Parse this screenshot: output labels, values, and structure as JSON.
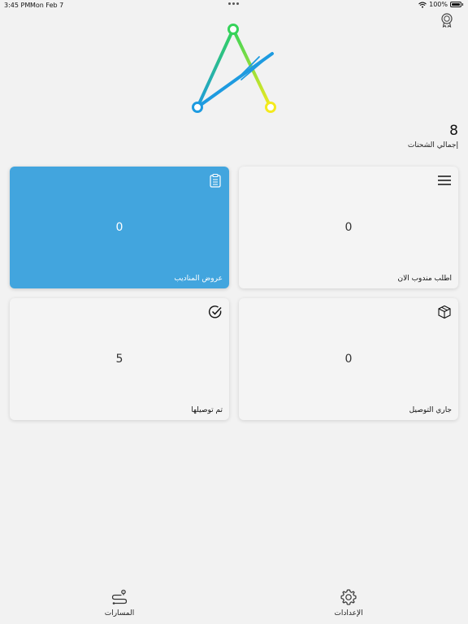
{
  "status_bar": {
    "time": "3:45 PM",
    "date": "Mon Feb 7",
    "battery": "100%"
  },
  "summary": {
    "total_count": "8",
    "total_label": "إجمالي الشحنات"
  },
  "cards": {
    "shipping_offers": {
      "label": "عروض المناديب",
      "value": "0",
      "icon": "clipboard-icon"
    },
    "request_agent": {
      "label": "اطلب مندوب الان",
      "value": "0",
      "icon": "menu-icon"
    },
    "delivered": {
      "label": "تم توصيلها",
      "value": "5",
      "icon": "check-circle-icon"
    },
    "in_delivery": {
      "label": "جاري التوصيل",
      "value": "0",
      "icon": "package-icon"
    }
  },
  "bottom_nav": {
    "routes_label": "المسارات",
    "settings_label": "الإعدادات"
  },
  "colors": {
    "accent": "#42a5de",
    "background": "#f2f2f2",
    "logo_blue": "#1e9be0",
    "logo_green": "#35d35a",
    "logo_yellow": "#f4ea1e"
  }
}
